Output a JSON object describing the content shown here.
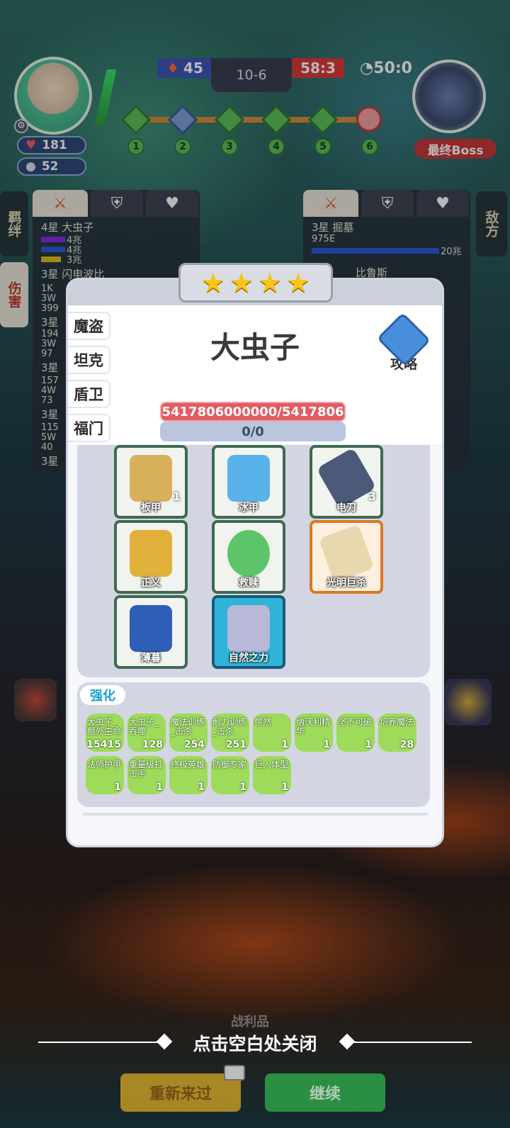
{
  "hud": {
    "hp": "181",
    "coins": "52",
    "score_left": "45",
    "stage": "10-6",
    "score_right": "58:3",
    "timer": "50:0",
    "boss_label": "最终Boss",
    "nodes": [
      "1",
      "2",
      "3",
      "4",
      "5",
      "6"
    ]
  },
  "left_panel": {
    "vtab_bond": "羁绊",
    "vtab_damage": "伤害",
    "lines": [
      "4星 大虫子",
      "4兆",
      "4兆",
      "3兆",
      "3星 闪电波比",
      "1K",
      "3W",
      "399",
      "3星",
      "194",
      "3W",
      "97",
      "3星",
      "157",
      "4W",
      "73",
      "3星",
      "115",
      "5W",
      "40",
      "3星"
    ]
  },
  "right_panel": {
    "vtab_enemy": "敌方",
    "name": "3星 掘墓",
    "val1": "975E",
    "val2": "20兆",
    "val3": "比鲁斯"
  },
  "modal": {
    "stars": 4,
    "class_tabs": [
      "魔盗",
      "坦克",
      "盾卫",
      "福门"
    ],
    "hero_name": "大虫子",
    "guide_label": "攻略",
    "hp_text": "5417806000000/5417806",
    "mp_text": "0/0",
    "equipment": [
      {
        "name": "板甲",
        "count": "1",
        "color": "#d9b05a"
      },
      {
        "name": "冰甲",
        "count": "",
        "color": "#5ab3e8"
      },
      {
        "name": "电刀",
        "count": "3",
        "color": "#4a5a78"
      },
      {
        "name": "正义",
        "count": "",
        "color": "#e0b03a"
      },
      {
        "name": "救赎",
        "count": "",
        "color": "#5ec46a"
      },
      {
        "name": "光明巨杀",
        "count": "",
        "color": "#e8d8b0"
      },
      {
        "name": "薄暮",
        "count": "",
        "color": "#2e5eb8"
      },
      {
        "name": "自然之力",
        "count": "",
        "color": "#b8b8d8"
      }
    ],
    "enhance_title": "强化",
    "enhancements": [
      {
        "name": "大虫子_额外生命",
        "value": "15415"
      },
      {
        "name": "大虫子_吞噬",
        "value": "128"
      },
      {
        "name": "魔法训练_击杀",
        "value": "254"
      },
      {
        "name": "耐力训练_击杀",
        "value": "251"
      },
      {
        "name": "愕然",
        "value": "1"
      },
      {
        "name": "纳沃利精华",
        "value": "1"
      },
      {
        "name": "坚不可破",
        "value": "1"
      },
      {
        "name": "培养魔法",
        "value": "28"
      },
      {
        "name": "法师护甲",
        "value": "1"
      },
      {
        "name": "重量级打击手",
        "value": "1"
      },
      {
        "name": "终极英雄",
        "value": "1"
      },
      {
        "name": "防御专家",
        "value": "1"
      },
      {
        "name": "巨人体型",
        "value": "1"
      }
    ]
  },
  "bottom": {
    "spoils": "战利品",
    "close_hint": "点击空白处关闭",
    "retry": "重新来过",
    "continue": "继续"
  },
  "colors": {
    "accent_green": "#5cc05a",
    "hp_red": "#e25c63",
    "enhance_chip": "#9edb5b"
  }
}
